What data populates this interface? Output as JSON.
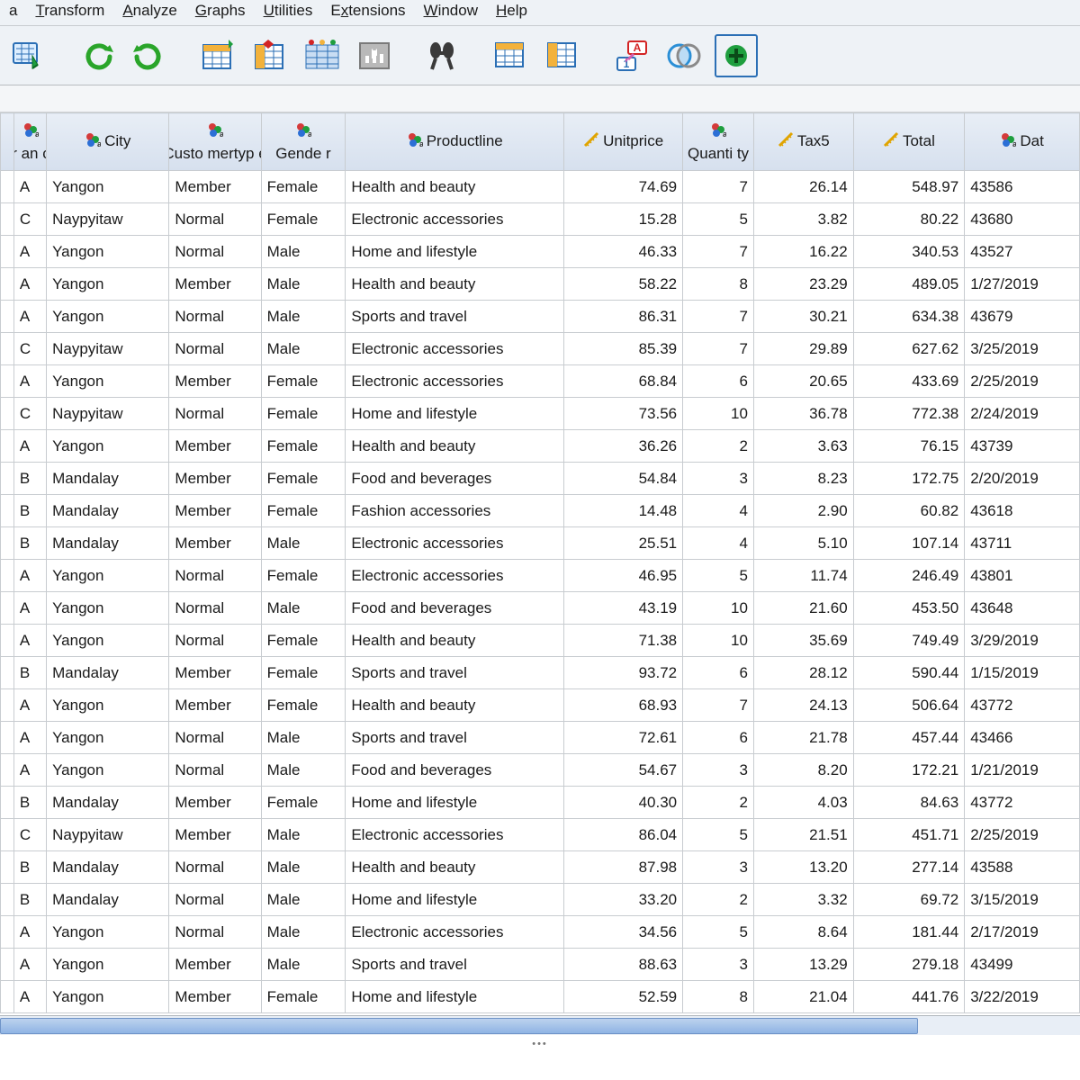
{
  "menu": {
    "items": [
      {
        "pre": "",
        "ul": "T",
        "post": "ransform"
      },
      {
        "pre": "",
        "ul": "A",
        "post": "nalyze"
      },
      {
        "pre": "",
        "ul": "G",
        "post": "raphs"
      },
      {
        "pre": "",
        "ul": "U",
        "post": "tilities"
      },
      {
        "pre": "E",
        "ul": "x",
        "post": "tensions"
      },
      {
        "pre": "",
        "ul": "W",
        "post": "indow"
      },
      {
        "pre": "",
        "ul": "H",
        "post": "elp"
      }
    ],
    "leading_fragment": "a"
  },
  "columns": [
    {
      "key": "stub",
      "label": "",
      "type": "stub"
    },
    {
      "key": "branch",
      "label": "Br an ch",
      "type": "nominal"
    },
    {
      "key": "city",
      "label": "City",
      "type": "nominal"
    },
    {
      "key": "custtype",
      "label": "Custo mertyp e",
      "type": "nominal"
    },
    {
      "key": "gender",
      "label": "Gende r",
      "type": "nominal"
    },
    {
      "key": "product",
      "label": "Productline",
      "type": "nominal"
    },
    {
      "key": "unitprice",
      "label": "Unitprice",
      "type": "scale"
    },
    {
      "key": "qty",
      "label": "Quanti ty",
      "type": "nominal"
    },
    {
      "key": "tax",
      "label": "Tax5",
      "type": "scale"
    },
    {
      "key": "total",
      "label": "Total",
      "type": "scale"
    },
    {
      "key": "date",
      "label": "Dat",
      "type": "nominal"
    }
  ],
  "rows": [
    {
      "branch": "A",
      "city": "Yangon",
      "cust": "Member",
      "gender": "Female",
      "product": "Health and beauty",
      "unit": "74.69",
      "qty": "7",
      "tax": "26.14",
      "total": "548.97",
      "date": "43586"
    },
    {
      "branch": "C",
      "city": "Naypyitaw",
      "cust": "Normal",
      "gender": "Female",
      "product": "Electronic accessories",
      "unit": "15.28",
      "qty": "5",
      "tax": "3.82",
      "total": "80.22",
      "date": "43680"
    },
    {
      "branch": "A",
      "city": "Yangon",
      "cust": "Normal",
      "gender": "Male",
      "product": "Home and lifestyle",
      "unit": "46.33",
      "qty": "7",
      "tax": "16.22",
      "total": "340.53",
      "date": "43527"
    },
    {
      "branch": "A",
      "city": "Yangon",
      "cust": "Member",
      "gender": "Male",
      "product": "Health and beauty",
      "unit": "58.22",
      "qty": "8",
      "tax": "23.29",
      "total": "489.05",
      "date": "1/27/2019"
    },
    {
      "branch": "A",
      "city": "Yangon",
      "cust": "Normal",
      "gender": "Male",
      "product": "Sports and travel",
      "unit": "86.31",
      "qty": "7",
      "tax": "30.21",
      "total": "634.38",
      "date": "43679"
    },
    {
      "branch": "C",
      "city": "Naypyitaw",
      "cust": "Normal",
      "gender": "Male",
      "product": "Electronic accessories",
      "unit": "85.39",
      "qty": "7",
      "tax": "29.89",
      "total": "627.62",
      "date": "3/25/2019"
    },
    {
      "branch": "A",
      "city": "Yangon",
      "cust": "Member",
      "gender": "Female",
      "product": "Electronic accessories",
      "unit": "68.84",
      "qty": "6",
      "tax": "20.65",
      "total": "433.69",
      "date": "2/25/2019"
    },
    {
      "branch": "C",
      "city": "Naypyitaw",
      "cust": "Normal",
      "gender": "Female",
      "product": "Home and lifestyle",
      "unit": "73.56",
      "qty": "10",
      "tax": "36.78",
      "total": "772.38",
      "date": "2/24/2019"
    },
    {
      "branch": "A",
      "city": "Yangon",
      "cust": "Member",
      "gender": "Female",
      "product": "Health and beauty",
      "unit": "36.26",
      "qty": "2",
      "tax": "3.63",
      "total": "76.15",
      "date": "43739"
    },
    {
      "branch": "B",
      "city": "Mandalay",
      "cust": "Member",
      "gender": "Female",
      "product": "Food and beverages",
      "unit": "54.84",
      "qty": "3",
      "tax": "8.23",
      "total": "172.75",
      "date": "2/20/2019"
    },
    {
      "branch": "B",
      "city": "Mandalay",
      "cust": "Member",
      "gender": "Female",
      "product": "Fashion accessories",
      "unit": "14.48",
      "qty": "4",
      "tax": "2.90",
      "total": "60.82",
      "date": "43618"
    },
    {
      "branch": "B",
      "city": "Mandalay",
      "cust": "Member",
      "gender": "Male",
      "product": "Electronic accessories",
      "unit": "25.51",
      "qty": "4",
      "tax": "5.10",
      "total": "107.14",
      "date": "43711"
    },
    {
      "branch": "A",
      "city": "Yangon",
      "cust": "Normal",
      "gender": "Female",
      "product": "Electronic accessories",
      "unit": "46.95",
      "qty": "5",
      "tax": "11.74",
      "total": "246.49",
      "date": "43801"
    },
    {
      "branch": "A",
      "city": "Yangon",
      "cust": "Normal",
      "gender": "Male",
      "product": "Food and beverages",
      "unit": "43.19",
      "qty": "10",
      "tax": "21.60",
      "total": "453.50",
      "date": "43648"
    },
    {
      "branch": "A",
      "city": "Yangon",
      "cust": "Normal",
      "gender": "Female",
      "product": "Health and beauty",
      "unit": "71.38",
      "qty": "10",
      "tax": "35.69",
      "total": "749.49",
      "date": "3/29/2019"
    },
    {
      "branch": "B",
      "city": "Mandalay",
      "cust": "Member",
      "gender": "Female",
      "product": "Sports and travel",
      "unit": "93.72",
      "qty": "6",
      "tax": "28.12",
      "total": "590.44",
      "date": "1/15/2019"
    },
    {
      "branch": "A",
      "city": "Yangon",
      "cust": "Member",
      "gender": "Female",
      "product": "Health and beauty",
      "unit": "68.93",
      "qty": "7",
      "tax": "24.13",
      "total": "506.64",
      "date": "43772"
    },
    {
      "branch": "A",
      "city": "Yangon",
      "cust": "Normal",
      "gender": "Male",
      "product": "Sports and travel",
      "unit": "72.61",
      "qty": "6",
      "tax": "21.78",
      "total": "457.44",
      "date": "43466"
    },
    {
      "branch": "A",
      "city": "Yangon",
      "cust": "Normal",
      "gender": "Male",
      "product": "Food and beverages",
      "unit": "54.67",
      "qty": "3",
      "tax": "8.20",
      "total": "172.21",
      "date": "1/21/2019"
    },
    {
      "branch": "B",
      "city": "Mandalay",
      "cust": "Member",
      "gender": "Female",
      "product": "Home and lifestyle",
      "unit": "40.30",
      "qty": "2",
      "tax": "4.03",
      "total": "84.63",
      "date": "43772"
    },
    {
      "branch": "C",
      "city": "Naypyitaw",
      "cust": "Member",
      "gender": "Male",
      "product": "Electronic accessories",
      "unit": "86.04",
      "qty": "5",
      "tax": "21.51",
      "total": "451.71",
      "date": "2/25/2019"
    },
    {
      "branch": "B",
      "city": "Mandalay",
      "cust": "Normal",
      "gender": "Male",
      "product": "Health and beauty",
      "unit": "87.98",
      "qty": "3",
      "tax": "13.20",
      "total": "277.14",
      "date": "43588"
    },
    {
      "branch": "B",
      "city": "Mandalay",
      "cust": "Normal",
      "gender": "Male",
      "product": "Home and lifestyle",
      "unit": "33.20",
      "qty": "2",
      "tax": "3.32",
      "total": "69.72",
      "date": "3/15/2019"
    },
    {
      "branch": "A",
      "city": "Yangon",
      "cust": "Normal",
      "gender": "Male",
      "product": "Electronic accessories",
      "unit": "34.56",
      "qty": "5",
      "tax": "8.64",
      "total": "181.44",
      "date": "2/17/2019"
    },
    {
      "branch": "A",
      "city": "Yangon",
      "cust": "Member",
      "gender": "Male",
      "product": "Sports and travel",
      "unit": "88.63",
      "qty": "3",
      "tax": "13.29",
      "total": "279.18",
      "date": "43499"
    },
    {
      "branch": "A",
      "city": "Yangon",
      "cust": "Member",
      "gender": "Female",
      "product": "Home and lifestyle",
      "unit": "52.59",
      "qty": "8",
      "tax": "21.04",
      "total": "441.76",
      "date": "3/22/2019"
    }
  ]
}
